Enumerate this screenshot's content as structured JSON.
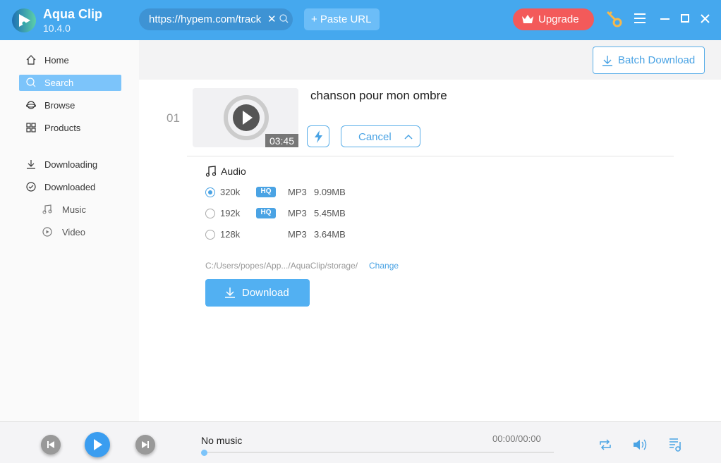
{
  "app": {
    "name": "Aqua Clip",
    "version": "10.4.0"
  },
  "header": {
    "url_value": "https://hypem.com/track",
    "paste_label": "+ Paste URL",
    "upgrade_label": "Upgrade"
  },
  "sidebar": {
    "items": [
      {
        "label": "Home"
      },
      {
        "label": "Search"
      },
      {
        "label": "Browse"
      },
      {
        "label": "Products"
      },
      {
        "label": "Downloading"
      },
      {
        "label": "Downloaded"
      },
      {
        "label": "Music"
      },
      {
        "label": "Video"
      }
    ]
  },
  "toolbar": {
    "batch_label": "Batch Download"
  },
  "item": {
    "index": "01",
    "title": "chanson pour mon ombre",
    "duration": "03:45",
    "cancel_label": "Cancel",
    "audio_label": "Audio",
    "options": [
      {
        "rate": "320k",
        "hq": "HQ",
        "format": "MP3",
        "size": "9.09MB",
        "selected": true
      },
      {
        "rate": "192k",
        "hq": "HQ",
        "format": "MP3",
        "size": "5.45MB",
        "selected": false
      },
      {
        "rate": "128k",
        "hq": "",
        "format": "MP3",
        "size": "3.64MB",
        "selected": false
      }
    ],
    "path": "C:/Users/popes/App.../AquaClip/storage/",
    "change_label": "Change",
    "download_label": "Download"
  },
  "player": {
    "track": "No music",
    "time": "00:00/00:00",
    "progress": 0
  },
  "colors": {
    "accent": "#45a8ee",
    "upgrade": "#f35a5a"
  }
}
